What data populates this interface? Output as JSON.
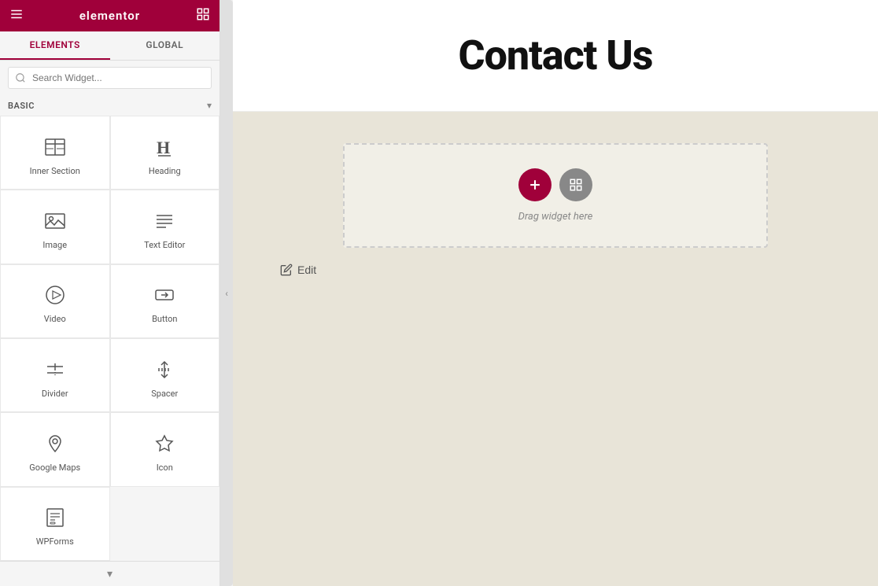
{
  "topbar": {
    "logo": "elementor",
    "menu_icon": "☰",
    "grid_icon": "⊞"
  },
  "tabs": [
    {
      "id": "elements",
      "label": "ELEMENTS",
      "active": true
    },
    {
      "id": "global",
      "label": "GLOBAL",
      "active": false
    }
  ],
  "search": {
    "placeholder": "Search Widget..."
  },
  "sections": {
    "basic": {
      "label": "BASIC"
    }
  },
  "widgets": [
    {
      "id": "inner-section",
      "label": "Inner Section",
      "icon": "inner-section-icon"
    },
    {
      "id": "heading",
      "label": "Heading",
      "icon": "heading-icon"
    },
    {
      "id": "image",
      "label": "Image",
      "icon": "image-icon"
    },
    {
      "id": "text-editor",
      "label": "Text Editor",
      "icon": "text-editor-icon"
    },
    {
      "id": "video",
      "label": "Video",
      "icon": "video-icon"
    },
    {
      "id": "button",
      "label": "Button",
      "icon": "button-icon"
    },
    {
      "id": "divider",
      "label": "Divider",
      "icon": "divider-icon"
    },
    {
      "id": "spacer",
      "label": "Spacer",
      "icon": "spacer-icon"
    },
    {
      "id": "google-maps",
      "label": "Google Maps",
      "icon": "google-maps-icon"
    },
    {
      "id": "icon",
      "label": "Icon",
      "icon": "icon-icon"
    },
    {
      "id": "wpforms",
      "label": "WPForms",
      "icon": "wpforms-icon"
    }
  ],
  "canvas": {
    "page_title": "Contact Us",
    "drag_label": "Drag widget here",
    "edit_label": "Edit"
  },
  "colors": {
    "brand": "#a0003a",
    "accent": "#888888",
    "canvas_bg": "#e8e4d8"
  }
}
